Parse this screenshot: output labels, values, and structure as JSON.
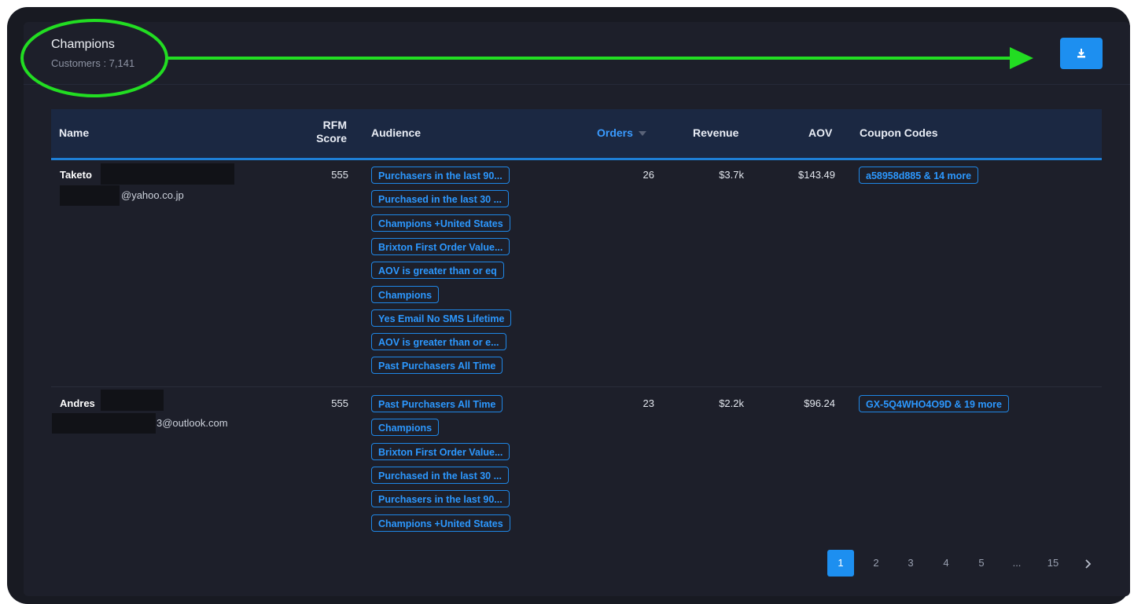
{
  "segment": {
    "title": "Champions",
    "customers_label": "Customers : 7,141"
  },
  "download_icon": "download-icon",
  "table": {
    "headers": {
      "name": "Name",
      "rfm_line1": "RFM",
      "rfm_line2": "Score",
      "audience": "Audience",
      "orders": "Orders",
      "revenue": "Revenue",
      "aov": "AOV",
      "coupons": "Coupon Codes"
    },
    "rows": [
      {
        "name": "Taketo",
        "email": "@yahoo.co.jp",
        "rfm": "555",
        "orders": "26",
        "revenue": "$3.7k",
        "aov": "$143.49",
        "coupon": "a58958d885 & 14 more",
        "audiences": [
          "Purchasers in the last 90...",
          "Purchased in the last 30 ...",
          "Champions +United States",
          "Brixton First Order Value...",
          "AOV is greater than or eq",
          "Champions",
          "Yes Email No SMS Lifetime",
          "AOV is greater than or e...",
          "Past Purchasers All Time"
        ]
      },
      {
        "name": "Andres",
        "email": "3@outlook.com",
        "rfm": "555",
        "orders": "23",
        "revenue": "$2.2k",
        "aov": "$96.24",
        "coupon": "GX-5Q4WHO4O9D & 19 more",
        "audiences": [
          "Past Purchasers All Time",
          "Champions",
          "Brixton First Order Value...",
          "Purchased in the last 30 ...",
          "Purchasers in the last 90...",
          "Champions +United States"
        ]
      }
    ]
  },
  "pagination": {
    "pages": [
      "1",
      "2",
      "3",
      "4",
      "5",
      "...",
      "15"
    ],
    "current": "1",
    "next_icon": "chevron-right-icon"
  },
  "colors": {
    "accent": "#1d8ff0",
    "annotation": "#22dd22"
  }
}
